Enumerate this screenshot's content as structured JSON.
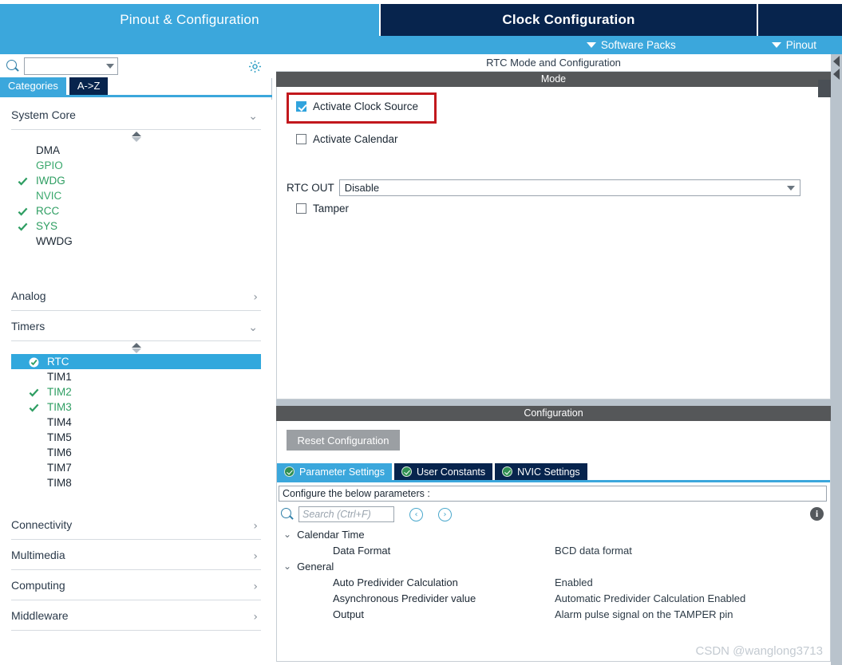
{
  "header": {
    "tabs": [
      {
        "label": "Pinout & Configuration",
        "selected": false
      },
      {
        "label": "Clock Configuration",
        "selected": true
      },
      {
        "label": "",
        "selected": false
      }
    ],
    "subbar": {
      "software_packs": "Software Packs",
      "pinout": "Pinout"
    },
    "colors": {
      "accent_light": "#3ba7dc",
      "accent_dark": "#07244d",
      "band_gray": "#555759",
      "highlight_red": "#c2181d",
      "green_check": "#2e9e62"
    }
  },
  "sidebar": {
    "search": {
      "value": "",
      "icon": "search-icon"
    },
    "gear_icon": "gear-icon",
    "view_tabs": [
      {
        "label": "Categories",
        "selected": true
      },
      {
        "label": "A->Z",
        "selected": false
      }
    ],
    "categories": [
      {
        "name": "System Core",
        "expanded": true,
        "items": [
          {
            "label": "DMA",
            "state": "plain"
          },
          {
            "label": "GPIO",
            "state": "green"
          },
          {
            "label": "IWDG",
            "state": "checked"
          },
          {
            "label": "NVIC",
            "state": "green"
          },
          {
            "label": "RCC",
            "state": "checked"
          },
          {
            "label": "SYS",
            "state": "checked"
          },
          {
            "label": "WWDG",
            "state": "plain"
          }
        ]
      },
      {
        "name": "Analog",
        "expanded": false,
        "items": []
      },
      {
        "name": "Timers",
        "expanded": true,
        "items": [
          {
            "label": "RTC",
            "state": "selected"
          },
          {
            "label": "TIM1",
            "state": "plain"
          },
          {
            "label": "TIM2",
            "state": "checked"
          },
          {
            "label": "TIM3",
            "state": "checked"
          },
          {
            "label": "TIM4",
            "state": "plain"
          },
          {
            "label": "TIM5",
            "state": "plain"
          },
          {
            "label": "TIM6",
            "state": "plain"
          },
          {
            "label": "TIM7",
            "state": "plain"
          },
          {
            "label": "TIM8",
            "state": "plain"
          }
        ]
      },
      {
        "name": "Connectivity",
        "expanded": false,
        "items": []
      },
      {
        "name": "Multimedia",
        "expanded": false,
        "items": []
      },
      {
        "name": "Computing",
        "expanded": false,
        "items": []
      },
      {
        "name": "Middleware",
        "expanded": false,
        "items": []
      }
    ]
  },
  "main": {
    "title": "RTC Mode and Configuration",
    "mode": {
      "band_label": "Mode",
      "activate_clock_source": {
        "label": "Activate Clock Source",
        "checked": true,
        "highlighted": true
      },
      "activate_calendar": {
        "label": "Activate Calendar",
        "checked": false
      },
      "rtc_out": {
        "label": "RTC OUT",
        "value": "Disable"
      },
      "tamper": {
        "label": "Tamper",
        "checked": false
      }
    },
    "configuration": {
      "band_label": "Configuration",
      "reset_button": "Reset Configuration",
      "tabs": [
        {
          "label": "Parameter Settings",
          "selected": true
        },
        {
          "label": "User Constants",
          "selected": false
        },
        {
          "label": "NVIC Settings",
          "selected": false
        }
      ],
      "note": "Configure the below parameters :",
      "search_placeholder": "Search (Ctrl+F)",
      "search_value": "",
      "prev_button": "‹",
      "next_button": "›",
      "info_icon": "info-icon",
      "groups": [
        {
          "name": "Calendar Time",
          "expanded": true,
          "rows": [
            {
              "name": "Data Format",
              "value": "BCD data format"
            }
          ]
        },
        {
          "name": "General",
          "expanded": true,
          "rows": [
            {
              "name": "Auto Predivider Calculation",
              "value": "Enabled"
            },
            {
              "name": "Asynchronous Predivider value",
              "value": "Automatic Predivider Calculation Enabled"
            },
            {
              "name": "Output",
              "value": "Alarm pulse signal on the TAMPER pin"
            }
          ]
        }
      ]
    }
  },
  "watermark": "CSDN @wanglong3713"
}
